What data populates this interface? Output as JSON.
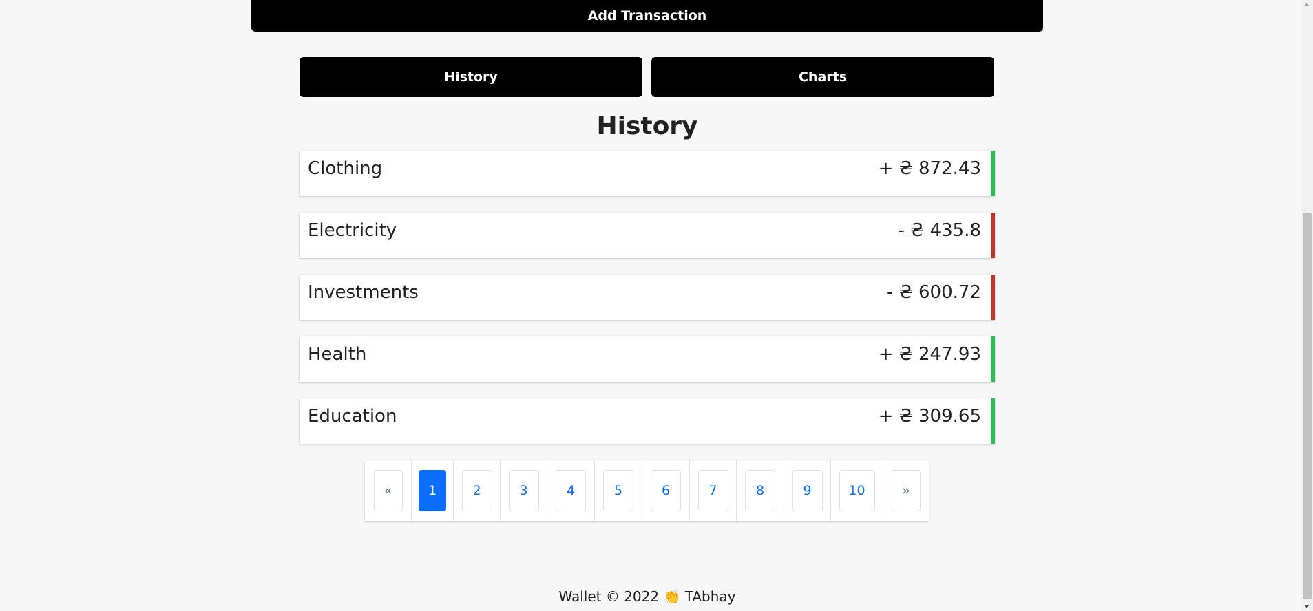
{
  "add_transaction_label": "Add Transaction",
  "tabs": [
    {
      "label": "History"
    },
    {
      "label": "Charts"
    }
  ],
  "history_title": "History",
  "transactions": [
    {
      "category": "Clothing",
      "amount": "+ ₴ 872.43",
      "type": "income",
      "color": "#2ebd59"
    },
    {
      "category": "Electricity",
      "amount": "- ₴ 435.8",
      "type": "expense",
      "color": "#b83a2e"
    },
    {
      "category": "Investments",
      "amount": "- ₴ 600.72",
      "type": "expense",
      "color": "#b83a2e"
    },
    {
      "category": "Health",
      "amount": "+ ₴ 247.93",
      "type": "income",
      "color": "#2ebd59"
    },
    {
      "category": "Education",
      "amount": "+ ₴ 309.65",
      "type": "income",
      "color": "#2ebd59"
    }
  ],
  "pagination": {
    "prev": "«",
    "next": "»",
    "pages": [
      "1",
      "2",
      "3",
      "4",
      "5",
      "6",
      "7",
      "8",
      "9",
      "10"
    ],
    "current": "1"
  },
  "footer": "Wallet © 2022 👏 TAbhay",
  "colors": {
    "income": "#2ebd59",
    "expense": "#b83a2e",
    "accent": "#0d6efd"
  }
}
